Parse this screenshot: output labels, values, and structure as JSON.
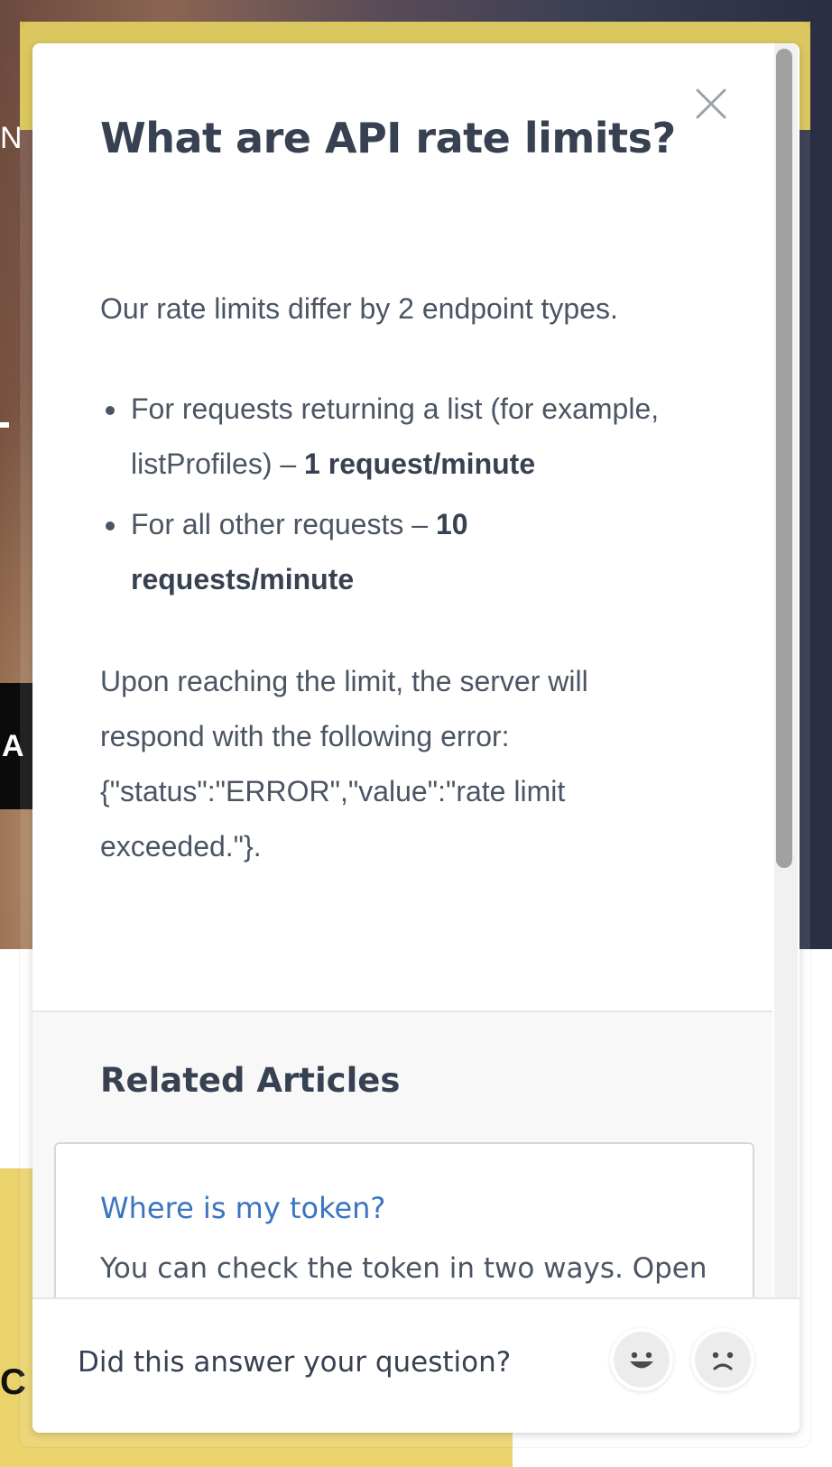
{
  "background_page": {
    "edge_letters": [
      "N",
      "A",
      "C"
    ]
  },
  "article_modal": {
    "title": "What are API rate limits?",
    "intro": "Our rate limits differ by 2 endpoint types.",
    "bullets": [
      {
        "text": "For requests returning a list (for example, listProfiles) – ",
        "bold": "1 request/minute"
      },
      {
        "text": "For all other requests – ",
        "bold": "10 requests/minute"
      }
    ],
    "error_paragraph": "Upon reaching the limit, the server will respond with the following error: {\"status\":\"ERROR\",\"value\":\"rate limit exceeded.\"}.",
    "close_icon": "close-icon"
  },
  "related_articles": {
    "heading": "Related Articles",
    "items": [
      {
        "title": "Where is my token?",
        "snippet": "You can check the token in two ways. Open"
      }
    ]
  },
  "feedback": {
    "question": "Did this answer your question?",
    "reactions": [
      "happy-face-icon",
      "sad-face-icon"
    ]
  },
  "colors": {
    "title_text": "#374151",
    "body_text": "#4b5563",
    "link": "#3b74c0",
    "background_yellow": "#d9c24e"
  }
}
